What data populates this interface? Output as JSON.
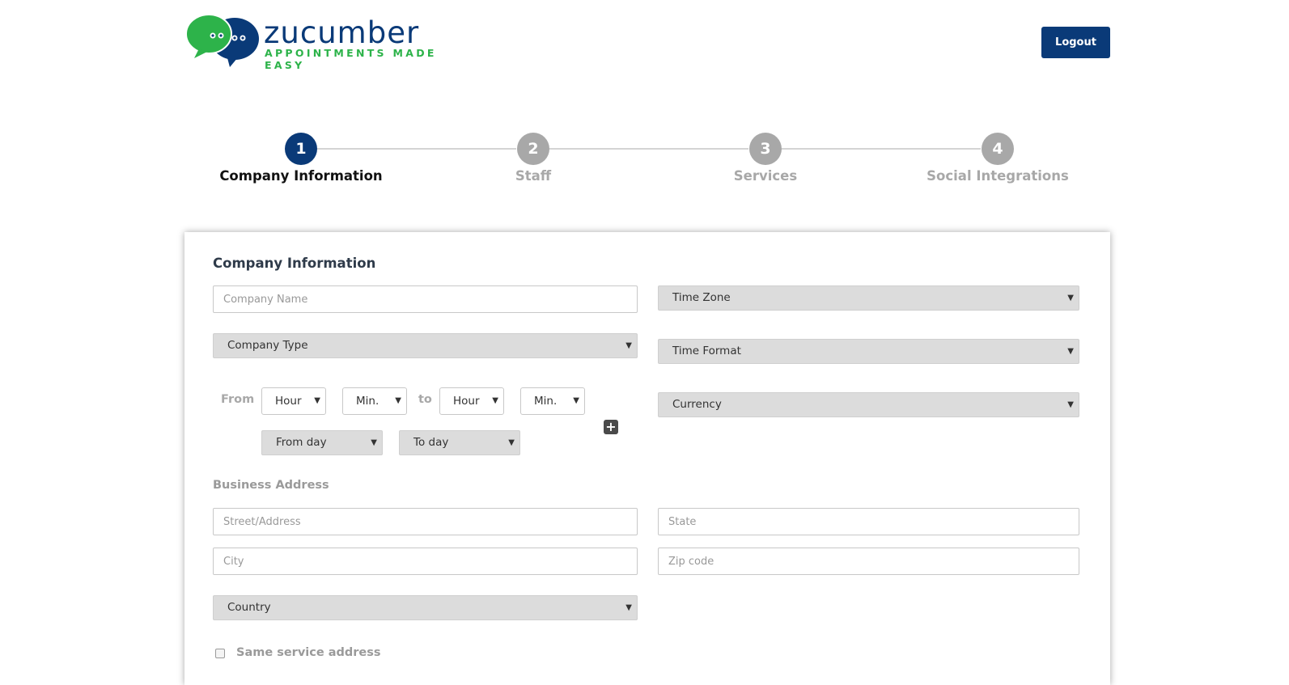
{
  "header": {
    "logo_word": "zucumber",
    "logo_tagline": "APPOINTMENTS MADE EASY",
    "logout_label": "Logout",
    "colors": {
      "brand_blue": "#0a3a78",
      "brand_green": "#2db34a"
    }
  },
  "stepper": {
    "steps": [
      {
        "number": "1",
        "label": "Company Information",
        "state": "active"
      },
      {
        "number": "2",
        "label": "Staff",
        "state": "inactive"
      },
      {
        "number": "3",
        "label": "Services",
        "state": "inactive"
      },
      {
        "number": "4",
        "label": "Social Integrations",
        "state": "inactive"
      }
    ]
  },
  "form": {
    "title": "Company Information",
    "company_name": {
      "placeholder": "Company Name",
      "value": ""
    },
    "company_type": {
      "selected": "Company Type"
    },
    "time_zone": {
      "selected": "Time Zone"
    },
    "time_format": {
      "selected": "Time Format"
    },
    "currency": {
      "selected": "Currency"
    },
    "hours": {
      "from_label": "From",
      "to_label": "to",
      "from_hour": "Hour",
      "from_min": "Min.",
      "to_hour": "Hour",
      "to_min": "Min.",
      "from_day": "From day",
      "to_day": "To day",
      "add_icon": "plus-icon"
    },
    "business_address": {
      "title": "Business Address",
      "street": {
        "placeholder": "Street/Address",
        "value": ""
      },
      "state": {
        "placeholder": "State",
        "value": ""
      },
      "city": {
        "placeholder": "City",
        "value": ""
      },
      "zip": {
        "placeholder": "Zip code",
        "value": ""
      },
      "country": {
        "selected": "Country"
      }
    },
    "same_service_address": {
      "label": "Same service address",
      "checked": false
    }
  }
}
